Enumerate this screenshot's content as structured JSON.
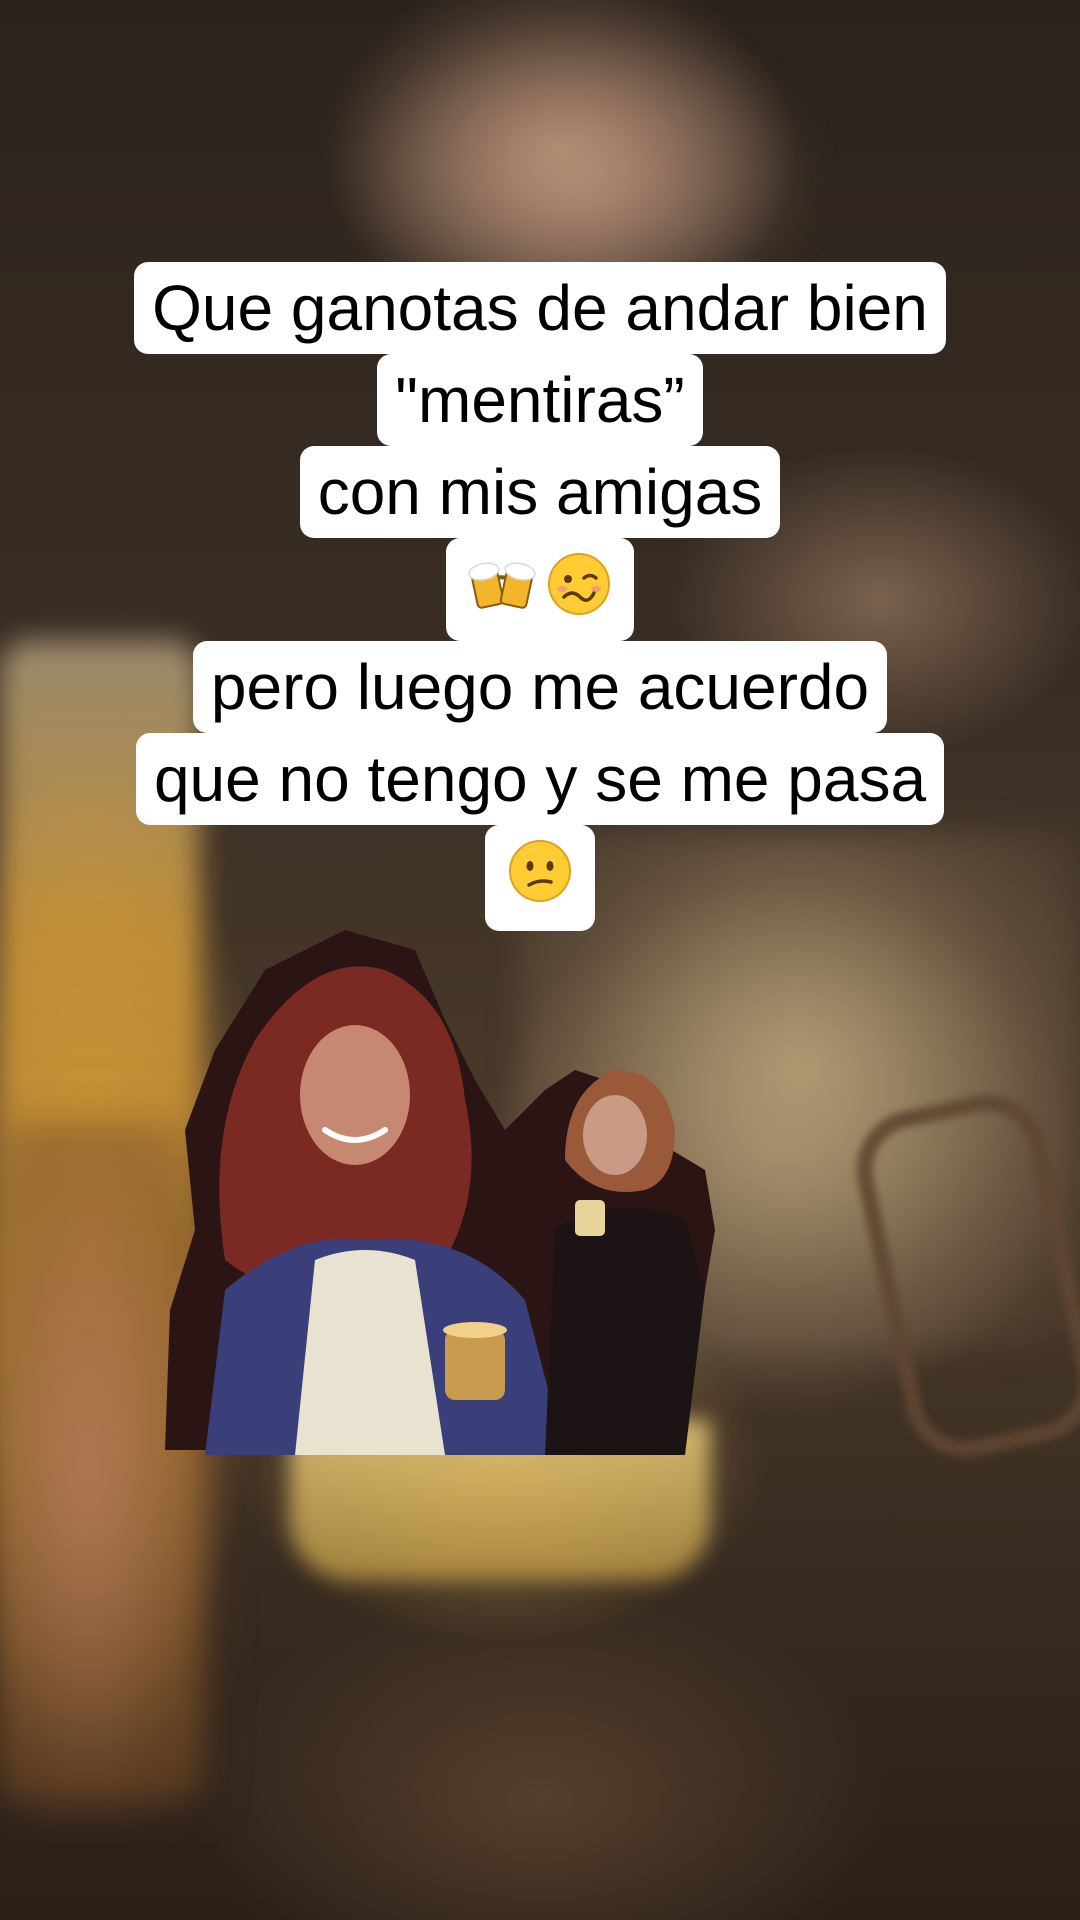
{
  "caption": {
    "lines": [
      "Que ganotas de andar bien",
      "\"mentiras”",
      "con mis amigas",
      "pero luego me acuerdo",
      "que no tengo y se me pasa"
    ],
    "emojis_1": [
      "beer-mugs",
      "woozy-face"
    ],
    "emojis_2": [
      "confused-face"
    ]
  },
  "colors": {
    "caption_bg": "#ffffff",
    "caption_text": "#000000",
    "beer": "#f3b52a",
    "emoji_face": "#ffcc33"
  }
}
